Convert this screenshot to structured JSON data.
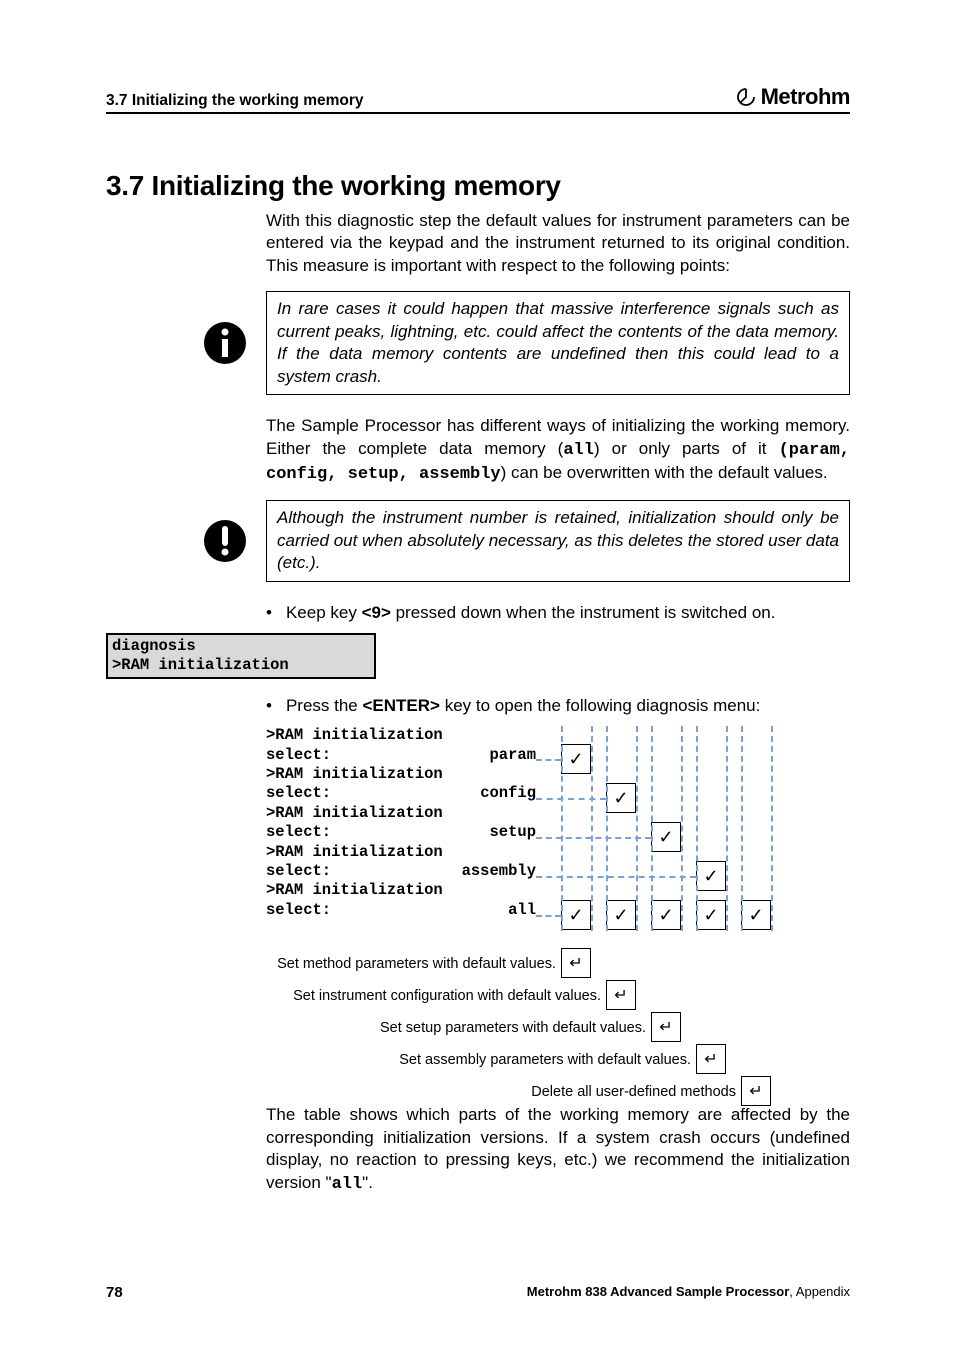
{
  "header": {
    "left": "3.7 Initializing the working memory",
    "brand": "Metrohm"
  },
  "title": "3.7  Initializing the working memory",
  "para1": "With this diagnostic step the default values for instrument parameters can be entered via the keypad and the instrument returned to its original condition. This measure is important with respect to the following points:",
  "note1": "In rare cases it could happen that massive interference signals such as current peaks, lightning, etc. could affect the contents of the data memory. If the data memory contents are undefined then this could lead to a system crash.",
  "para2_a": "The Sample Processor has different ways of initializing the working memory. Either the complete data memory (",
  "para2_all": "all",
  "para2_b": ") or only parts of it ",
  "para2_opts": "(param, config, setup, assembly",
  "para2_c": ") can be overwritten with the default values.",
  "note2": "Although the instrument number is retained, initialization should only be carried out when absolutely necessary, as this deletes the stored user data (etc.).",
  "bullet1_a": "Keep key ",
  "bullet1_key": "<9>",
  "bullet1_b": " pressed down when the instrument is switched on.",
  "lcd": {
    "l1": "diagnosis",
    "l2": ">RAM initialization"
  },
  "bullet2_a": "Press the ",
  "bullet2_key": "<ENTER>",
  "bullet2_b": " key to open the following diagnosis menu:",
  "menu": {
    "header": ">RAM initialization",
    "select": "select:",
    "items": [
      "param",
      "config",
      "setup",
      "assembly",
      "all"
    ]
  },
  "descs": [
    "Set method parameters with default values.",
    "Set instrument configuration with default values.",
    "Set setup parameters with default values.",
    "Set assembly parameters with default values.",
    "Delete all user-defined methods"
  ],
  "chart_data": {
    "type": "table",
    "rows": [
      "param",
      "config",
      "setup",
      "assembly",
      "all"
    ],
    "columns": [
      "method_params",
      "instrument_config",
      "setup_params",
      "assembly_params",
      "user_methods"
    ],
    "matrix": [
      [
        true,
        false,
        false,
        false,
        false
      ],
      [
        false,
        true,
        false,
        false,
        false
      ],
      [
        false,
        false,
        true,
        false,
        false
      ],
      [
        false,
        false,
        false,
        true,
        false
      ],
      [
        true,
        true,
        true,
        true,
        true
      ]
    ]
  },
  "para3_a": "The table shows which parts of the working memory are affected by the corresponding initialization versions. If a system crash occurs (undefined display, no reaction to pressing keys, etc.) we recommend the initialization version \"",
  "para3_all": "all",
  "para3_b": "\".",
  "footer": {
    "page": "78",
    "right_bold": "Metrohm 838 Advanced Sample Processor",
    "right_plain": ", Appendix"
  }
}
